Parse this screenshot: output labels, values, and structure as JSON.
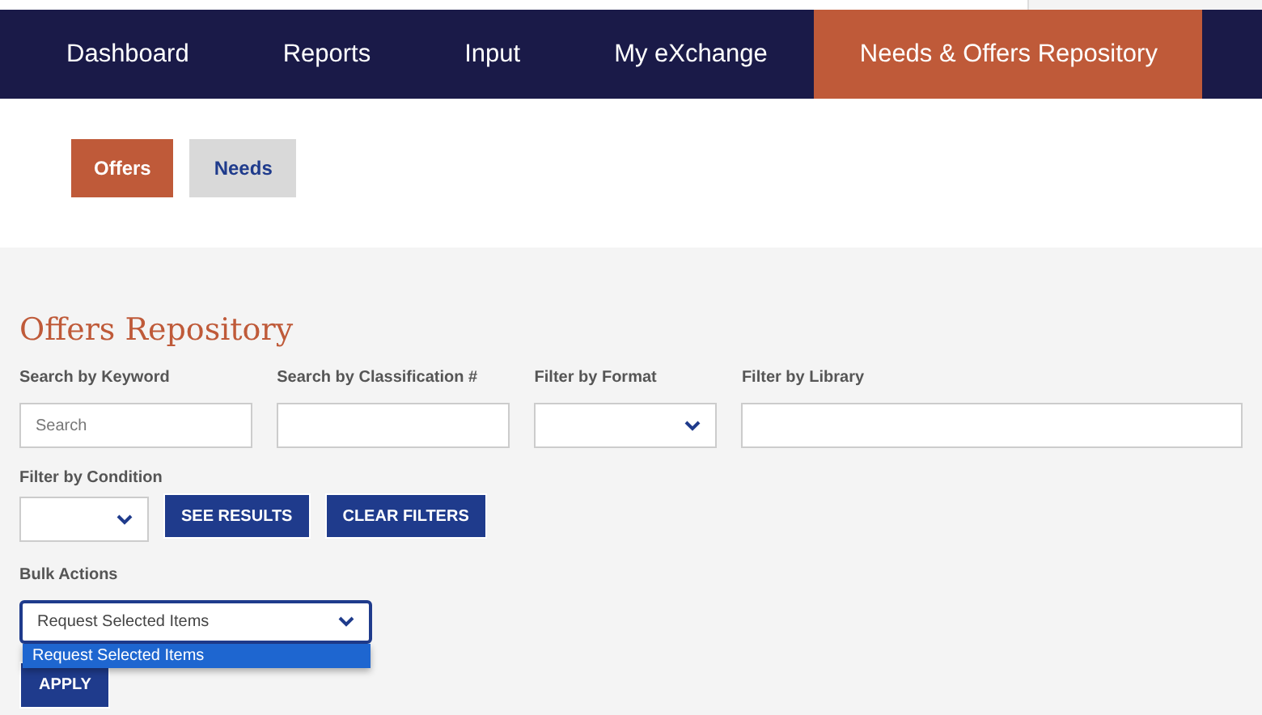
{
  "nav": [
    {
      "label": "Dashboard",
      "selected": false
    },
    {
      "label": "Reports",
      "selected": false
    },
    {
      "label": "Input",
      "selected": false
    },
    {
      "label": "My eXchange",
      "selected": false
    },
    {
      "label": "Needs & Offers Repository",
      "selected": true
    }
  ],
  "subtabs": [
    {
      "label": "Offers",
      "selected": true
    },
    {
      "label": "Needs",
      "selected": false
    }
  ],
  "title": "Offers Repository",
  "filters": [
    {
      "label": "Search by Keyword",
      "kind": "text",
      "placeholder": "Search"
    },
    {
      "label": "Search by Classification #",
      "kind": "text"
    },
    {
      "label": "Filter by Format",
      "kind": "select"
    },
    {
      "label": "Filter by Library",
      "kind": "text"
    }
  ],
  "condition": {
    "label": "Filter by Condition",
    "kind": "select"
  },
  "buttons": [
    "SEE RESULTS",
    "CLEAR FILTERS"
  ],
  "bulk": {
    "label": "Bulk Actions",
    "value": "Request Selected Items",
    "expanded": true,
    "options": [
      {
        "label": "Request Selected Items",
        "selected": true
      }
    ],
    "apply": "APPLY"
  }
}
